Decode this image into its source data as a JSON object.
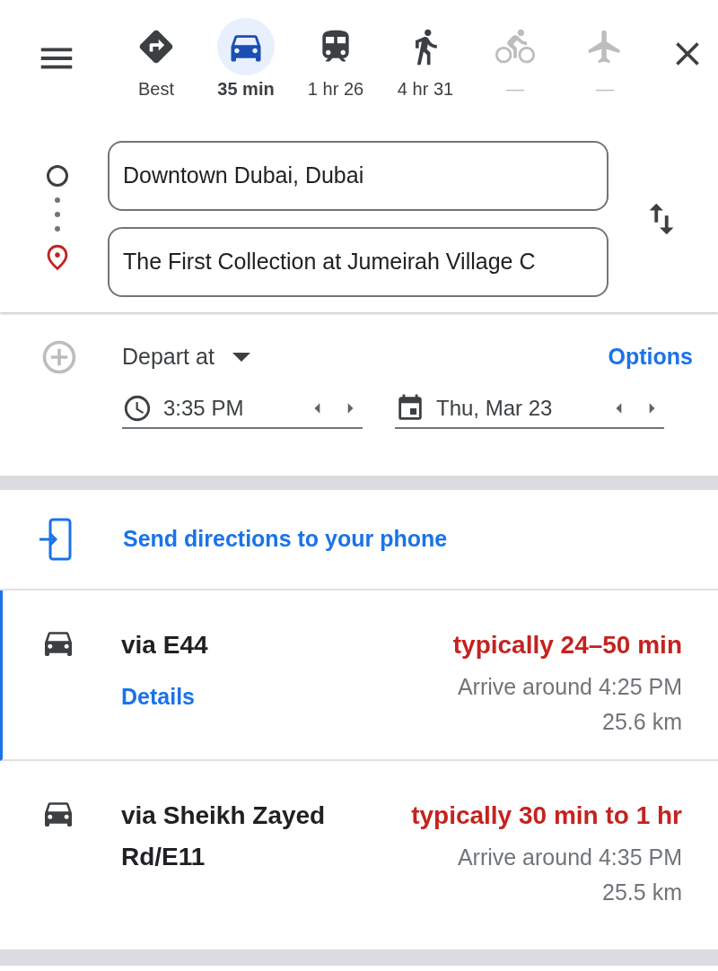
{
  "modes": [
    {
      "kind": "best",
      "label": "Best",
      "selected": false,
      "disabled": false
    },
    {
      "kind": "car",
      "label": "35 min",
      "selected": true,
      "disabled": false
    },
    {
      "kind": "transit",
      "label": "1 hr 26",
      "selected": false,
      "disabled": false
    },
    {
      "kind": "walk",
      "label": "4 hr 31",
      "selected": false,
      "disabled": false
    },
    {
      "kind": "bike",
      "label": "—",
      "selected": false,
      "disabled": true
    },
    {
      "kind": "flight",
      "label": "—",
      "selected": false,
      "disabled": true
    }
  ],
  "origin": {
    "value": "Downtown Dubai, Dubai"
  },
  "destination": {
    "value": "The First Collection at Jumeirah Village C"
  },
  "depart": {
    "mode": "Depart at",
    "options": "Options",
    "time": "3:35 PM",
    "date": "Thu, Mar 23"
  },
  "send_to_phone": "Send directions to your phone",
  "routes": [
    {
      "name": "via E44",
      "duration": "typically 24–50 min",
      "arrival": "Arrive around 4:25 PM",
      "distance": "25.6 km",
      "details": "Details",
      "selected": true
    },
    {
      "name": "via Sheikh Zayed Rd/E11",
      "duration": "typically 30 min to 1 hr",
      "arrival": "Arrive around 4:35 PM",
      "distance": "25.5 km",
      "selected": false
    }
  ]
}
